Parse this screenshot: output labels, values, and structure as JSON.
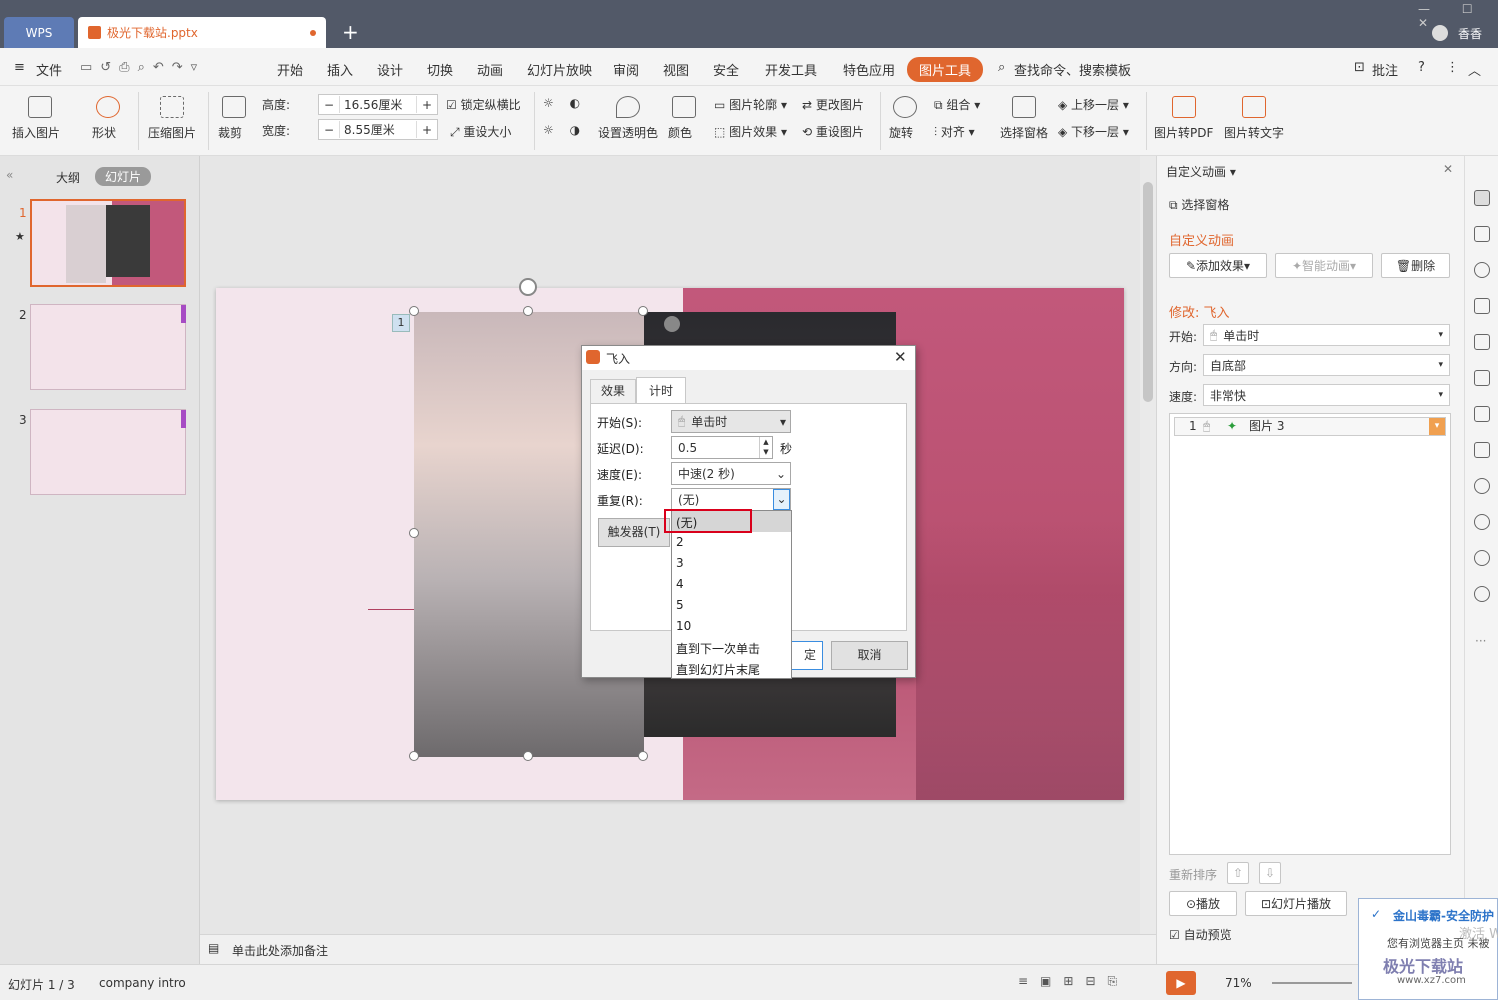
{
  "titlebar": {
    "wps_label": "WPS",
    "file_tab": "极光下载站.pptx",
    "user": "香香",
    "new_tab": "+"
  },
  "menu": {
    "file": "文件",
    "items": [
      "开始",
      "插入",
      "设计",
      "切换",
      "动画",
      "幻灯片放映",
      "审阅",
      "视图",
      "安全",
      "开发工具",
      "特色应用"
    ],
    "active": "图片工具",
    "search": "查找命令、搜索模板",
    "comment": "批注"
  },
  "ribbon": {
    "insert_picture": "插入图片",
    "shape": "形状",
    "compress": "压缩图片",
    "crop": "裁剪",
    "height_label": "高度:",
    "height_value": "16.56厘米",
    "width_label": "宽度:",
    "width_value": "8.55厘米",
    "lock_ratio": "锁定纵横比",
    "reset_size": "重设大小",
    "transparent": "设置透明色",
    "color": "颜色",
    "outline": "图片轮廓",
    "effect": "图片效果",
    "change_pic": "更改图片",
    "reset_pic": "重设图片",
    "rotate": "旋转",
    "group": "组合",
    "align": "对齐",
    "selection_pane": "选择窗格",
    "bring_forward": "上移一层",
    "send_backward": "下移一层",
    "to_pdf": "图片转PDF",
    "to_text": "图片转文字"
  },
  "left_panel": {
    "outline_tab": "大纲",
    "slides_tab": "幻灯片",
    "slide_numbers": [
      "1",
      "2",
      "3"
    ]
  },
  "slide": {
    "anim_tag": "1"
  },
  "dialog": {
    "title": "飞入",
    "tab_effect": "效果",
    "tab_timing": "计时",
    "start_label": "开始(S):",
    "start_value": "单击时",
    "delay_label": "延迟(D):",
    "delay_value": "0.5",
    "delay_unit": "秒",
    "speed_label": "速度(E):",
    "speed_value": "中速(2 秒)",
    "repeat_label": "重复(R):",
    "repeat_value": "(无)",
    "trigger_btn": "触发器(T)",
    "ok_btn": "定",
    "cancel_btn": "取消",
    "repeat_options": [
      "(无)",
      "2",
      "3",
      "4",
      "5",
      "10",
      "直到下一次单击",
      "直到幻灯片末尾"
    ]
  },
  "right_panel": {
    "title": "自定义动画",
    "select_pane": "选择窗格",
    "section": "自定义动画",
    "add_effect": "添加效果",
    "smart_anim": "智能动画",
    "delete": "删除",
    "modify": "修改: 飞入",
    "start_label": "开始:",
    "start_value": "单击时",
    "direction_label": "方向:",
    "direction_value": "自底部",
    "speed_label": "速度:",
    "speed_value": "非常快",
    "list_item_num": "1",
    "list_item_name": "图片 3",
    "reorder": "重新排序",
    "play": "播放",
    "slideshow": "幻灯片播放",
    "auto_preview": "自动预览"
  },
  "notes": {
    "placeholder": "单击此处添加备注"
  },
  "status": {
    "slide_info": "幻灯片 1 / 3",
    "theme": "company intro",
    "zoom": "71%"
  },
  "popup": {
    "title": "金山毒霸-安全防护",
    "body": "您有浏览器主页 未被",
    "watermark": "激活 W",
    "logo": "极光下载站",
    "url": "www.xz7.com"
  },
  "colors": {
    "accent": "#e0662e",
    "titlebar": "#525968",
    "slide_pink": "#c2587b",
    "highlight_red": "#d9001b"
  }
}
